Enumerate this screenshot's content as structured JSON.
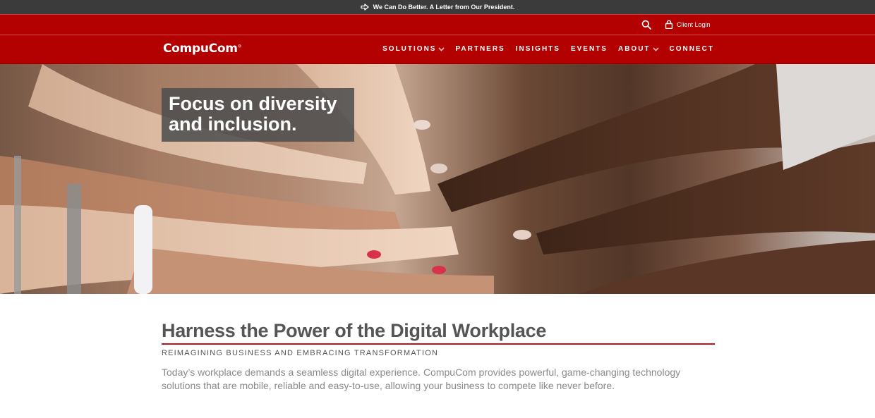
{
  "announcement": {
    "text": "We Can Do Better. A Letter from Our President."
  },
  "utility": {
    "login_label": "Client Login"
  },
  "brand": {
    "name": "CompuCom",
    "mark": "®"
  },
  "nav": [
    {
      "label": "SOLUTIONS",
      "dropdown": true
    },
    {
      "label": "PARTNERS",
      "dropdown": false
    },
    {
      "label": "INSIGHTS",
      "dropdown": false
    },
    {
      "label": "EVENTS",
      "dropdown": false
    },
    {
      "label": "ABOUT",
      "dropdown": true
    },
    {
      "label": "CONNECT",
      "dropdown": false
    }
  ],
  "hero": {
    "headline_line1": "Focus on diversity",
    "headline_line2": "and inclusion."
  },
  "content": {
    "title": "Harness the Power of the Digital Workplace",
    "subtitle": "REIMAGINING BUSINESS AND EMBRACING TRANSFORMATION",
    "body": "Today’s workplace demands a seamless digital experience. CompuCom provides powerful, game-changing technology solutions that are mobile, reliable and easy-to-use, allowing your business to compete like never before."
  },
  "colors": {
    "brand_red": "#b30000",
    "announce_bg": "#3b3b3b",
    "accent_rule": "#c0141a"
  },
  "icons": [
    "arrow-right-icon",
    "search-icon",
    "lock-icon",
    "chevron-down-icon"
  ]
}
